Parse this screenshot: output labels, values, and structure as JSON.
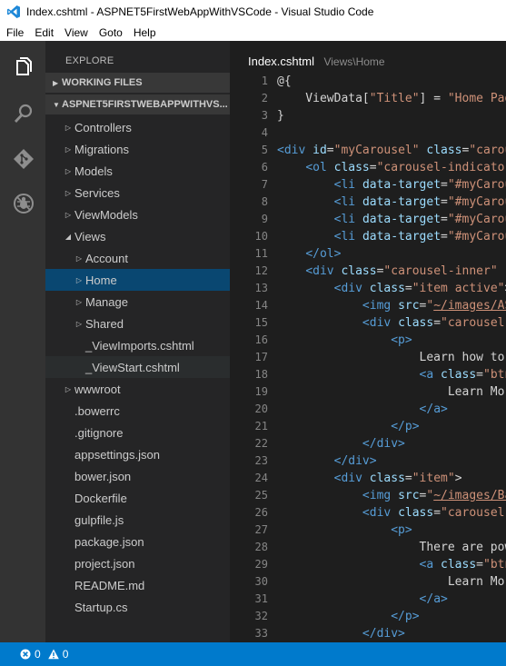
{
  "window": {
    "title": "Index.cshtml - ASPNET5FirstWebAppWithVSCode - Visual Studio Code"
  },
  "menu": [
    "File",
    "Edit",
    "View",
    "Goto",
    "Help"
  ],
  "activity": [
    "files-icon",
    "search-icon",
    "git-icon",
    "debug-icon"
  ],
  "sidebar": {
    "title": "EXPLORE",
    "working_files": "WORKING FILES",
    "project": "ASPNET5FIRSTWEBAPPWITHVS...",
    "tree": [
      {
        "label": "Controllers",
        "depth": 1,
        "twisty": "closed"
      },
      {
        "label": "Migrations",
        "depth": 1,
        "twisty": "closed"
      },
      {
        "label": "Models",
        "depth": 1,
        "twisty": "closed"
      },
      {
        "label": "Services",
        "depth": 1,
        "twisty": "closed"
      },
      {
        "label": "ViewModels",
        "depth": 1,
        "twisty": "closed"
      },
      {
        "label": "Views",
        "depth": 1,
        "twisty": "open"
      },
      {
        "label": "Account",
        "depth": 2,
        "twisty": "closed"
      },
      {
        "label": "Home",
        "depth": 2,
        "twisty": "closed",
        "state": "selected"
      },
      {
        "label": "Manage",
        "depth": 2,
        "twisty": "closed"
      },
      {
        "label": "Shared",
        "depth": 2,
        "twisty": "closed"
      },
      {
        "label": "_ViewImports.cshtml",
        "depth": 2,
        "twisty": "none"
      },
      {
        "label": "_ViewStart.cshtml",
        "depth": 2,
        "twisty": "none",
        "state": "hover"
      },
      {
        "label": "wwwroot",
        "depth": 1,
        "twisty": "closed"
      },
      {
        "label": ".bowerrc",
        "depth": 1,
        "twisty": "none"
      },
      {
        "label": ".gitignore",
        "depth": 1,
        "twisty": "none"
      },
      {
        "label": "appsettings.json",
        "depth": 1,
        "twisty": "none"
      },
      {
        "label": "bower.json",
        "depth": 1,
        "twisty": "none"
      },
      {
        "label": "Dockerfile",
        "depth": 1,
        "twisty": "none"
      },
      {
        "label": "gulpfile.js",
        "depth": 1,
        "twisty": "none"
      },
      {
        "label": "package.json",
        "depth": 1,
        "twisty": "none"
      },
      {
        "label": "project.json",
        "depth": 1,
        "twisty": "none"
      },
      {
        "label": "README.md",
        "depth": 1,
        "twisty": "none"
      },
      {
        "label": "Startup.cs",
        "depth": 1,
        "twisty": "none"
      }
    ]
  },
  "editor": {
    "file": "Index.cshtml",
    "path": "Views\\Home",
    "lines": [
      {
        "n": "1",
        "tokens": [
          [
            "t-razor",
            "@{"
          ]
        ]
      },
      {
        "n": "2",
        "tokens": [
          [
            "t-def",
            "    ViewData["
          ],
          [
            "t-str",
            "\"Title\""
          ],
          [
            "t-def",
            "] = "
          ],
          [
            "t-str",
            "\"Home Pag"
          ]
        ]
      },
      {
        "n": "3",
        "tokens": [
          [
            "t-def",
            "}"
          ]
        ]
      },
      {
        "n": "4",
        "tokens": []
      },
      {
        "n": "5",
        "tokens": [
          [
            "t-tag",
            "<div"
          ],
          [
            "t-def",
            " "
          ],
          [
            "t-attr",
            "id"
          ],
          [
            "t-def",
            "="
          ],
          [
            "t-str",
            "\"myCarousel\""
          ],
          [
            "t-def",
            " "
          ],
          [
            "t-attr",
            "class"
          ],
          [
            "t-def",
            "="
          ],
          [
            "t-str",
            "\"carou"
          ]
        ]
      },
      {
        "n": "6",
        "tokens": [
          [
            "t-def",
            "    "
          ],
          [
            "t-tag",
            "<ol"
          ],
          [
            "t-def",
            " "
          ],
          [
            "t-attr",
            "class"
          ],
          [
            "t-def",
            "="
          ],
          [
            "t-str",
            "\"carousel-indicator"
          ]
        ]
      },
      {
        "n": "7",
        "tokens": [
          [
            "t-def",
            "        "
          ],
          [
            "t-tag",
            "<li"
          ],
          [
            "t-def",
            " "
          ],
          [
            "t-attr",
            "data-target"
          ],
          [
            "t-def",
            "="
          ],
          [
            "t-str",
            "\"#myCarou"
          ]
        ]
      },
      {
        "n": "8",
        "tokens": [
          [
            "t-def",
            "        "
          ],
          [
            "t-tag",
            "<li"
          ],
          [
            "t-def",
            " "
          ],
          [
            "t-attr",
            "data-target"
          ],
          [
            "t-def",
            "="
          ],
          [
            "t-str",
            "\"#myCarou"
          ]
        ]
      },
      {
        "n": "9",
        "tokens": [
          [
            "t-def",
            "        "
          ],
          [
            "t-tag",
            "<li"
          ],
          [
            "t-def",
            " "
          ],
          [
            "t-attr",
            "data-target"
          ],
          [
            "t-def",
            "="
          ],
          [
            "t-str",
            "\"#myCarou"
          ]
        ]
      },
      {
        "n": "10",
        "tokens": [
          [
            "t-def",
            "        "
          ],
          [
            "t-tag",
            "<li"
          ],
          [
            "t-def",
            " "
          ],
          [
            "t-attr",
            "data-target"
          ],
          [
            "t-def",
            "="
          ],
          [
            "t-str",
            "\"#myCarou"
          ]
        ]
      },
      {
        "n": "11",
        "tokens": [
          [
            "t-def",
            "    "
          ],
          [
            "t-tag",
            "</ol>"
          ]
        ]
      },
      {
        "n": "12",
        "tokens": [
          [
            "t-def",
            "    "
          ],
          [
            "t-tag",
            "<div"
          ],
          [
            "t-def",
            " "
          ],
          [
            "t-attr",
            "class"
          ],
          [
            "t-def",
            "="
          ],
          [
            "t-str",
            "\"carousel-inner\""
          ],
          [
            "t-def",
            " r"
          ]
        ]
      },
      {
        "n": "13",
        "tokens": [
          [
            "t-def",
            "        "
          ],
          [
            "t-tag",
            "<div"
          ],
          [
            "t-def",
            " "
          ],
          [
            "t-attr",
            "class"
          ],
          [
            "t-def",
            "="
          ],
          [
            "t-str",
            "\"item active\""
          ],
          [
            "t-def",
            ">"
          ]
        ]
      },
      {
        "n": "14",
        "tokens": [
          [
            "t-def",
            "            "
          ],
          [
            "t-tag",
            "<img"
          ],
          [
            "t-def",
            " "
          ],
          [
            "t-attr",
            "src"
          ],
          [
            "t-def",
            "="
          ],
          [
            "t-str",
            "\""
          ],
          [
            "t-link",
            "~/images/AS"
          ]
        ]
      },
      {
        "n": "15",
        "tokens": [
          [
            "t-def",
            "            "
          ],
          [
            "t-tag",
            "<div"
          ],
          [
            "t-def",
            " "
          ],
          [
            "t-attr",
            "class"
          ],
          [
            "t-def",
            "="
          ],
          [
            "t-str",
            "\"carousel-"
          ]
        ]
      },
      {
        "n": "16",
        "tokens": [
          [
            "t-def",
            "                "
          ],
          [
            "t-tag",
            "<p>"
          ]
        ]
      },
      {
        "n": "17",
        "tokens": [
          [
            "t-def",
            "                    Learn how to"
          ]
        ]
      },
      {
        "n": "18",
        "tokens": [
          [
            "t-def",
            "                    "
          ],
          [
            "t-tag",
            "<a"
          ],
          [
            "t-def",
            " "
          ],
          [
            "t-attr",
            "class"
          ],
          [
            "t-def",
            "="
          ],
          [
            "t-str",
            "\"btn"
          ]
        ]
      },
      {
        "n": "19",
        "tokens": [
          [
            "t-def",
            "                        Learn Mor"
          ]
        ]
      },
      {
        "n": "20",
        "tokens": [
          [
            "t-def",
            "                    "
          ],
          [
            "t-tag",
            "</a>"
          ]
        ]
      },
      {
        "n": "21",
        "tokens": [
          [
            "t-def",
            "                "
          ],
          [
            "t-tag",
            "</p>"
          ]
        ]
      },
      {
        "n": "22",
        "tokens": [
          [
            "t-def",
            "            "
          ],
          [
            "t-tag",
            "</div>"
          ]
        ]
      },
      {
        "n": "23",
        "tokens": [
          [
            "t-def",
            "        "
          ],
          [
            "t-tag",
            "</div>"
          ]
        ]
      },
      {
        "n": "24",
        "tokens": [
          [
            "t-def",
            "        "
          ],
          [
            "t-tag",
            "<div"
          ],
          [
            "t-def",
            " "
          ],
          [
            "t-attr",
            "class"
          ],
          [
            "t-def",
            "="
          ],
          [
            "t-str",
            "\"item\""
          ],
          [
            "t-def",
            ">"
          ]
        ]
      },
      {
        "n": "25",
        "tokens": [
          [
            "t-def",
            "            "
          ],
          [
            "t-tag",
            "<img"
          ],
          [
            "t-def",
            " "
          ],
          [
            "t-attr",
            "src"
          ],
          [
            "t-def",
            "="
          ],
          [
            "t-str",
            "\""
          ],
          [
            "t-link",
            "~/images/Ba"
          ]
        ]
      },
      {
        "n": "26",
        "tokens": [
          [
            "t-def",
            "            "
          ],
          [
            "t-tag",
            "<div"
          ],
          [
            "t-def",
            " "
          ],
          [
            "t-attr",
            "class"
          ],
          [
            "t-def",
            "="
          ],
          [
            "t-str",
            "\"carousel-"
          ]
        ]
      },
      {
        "n": "27",
        "tokens": [
          [
            "t-def",
            "                "
          ],
          [
            "t-tag",
            "<p>"
          ]
        ]
      },
      {
        "n": "28",
        "tokens": [
          [
            "t-def",
            "                    There are pow"
          ]
        ]
      },
      {
        "n": "29",
        "tokens": [
          [
            "t-def",
            "                    "
          ],
          [
            "t-tag",
            "<a"
          ],
          [
            "t-def",
            " "
          ],
          [
            "t-attr",
            "class"
          ],
          [
            "t-def",
            "="
          ],
          [
            "t-str",
            "\"btn"
          ]
        ]
      },
      {
        "n": "30",
        "tokens": [
          [
            "t-def",
            "                        Learn Mor"
          ]
        ]
      },
      {
        "n": "31",
        "tokens": [
          [
            "t-def",
            "                    "
          ],
          [
            "t-tag",
            "</a>"
          ]
        ]
      },
      {
        "n": "32",
        "tokens": [
          [
            "t-def",
            "                "
          ],
          [
            "t-tag",
            "</p>"
          ]
        ]
      },
      {
        "n": "33",
        "tokens": [
          [
            "t-def",
            "            "
          ],
          [
            "t-tag",
            "</div>"
          ]
        ]
      }
    ]
  },
  "status": {
    "errors": "0",
    "warnings": "0"
  },
  "colors": {
    "accent": "#007acc",
    "selection": "#094771"
  }
}
